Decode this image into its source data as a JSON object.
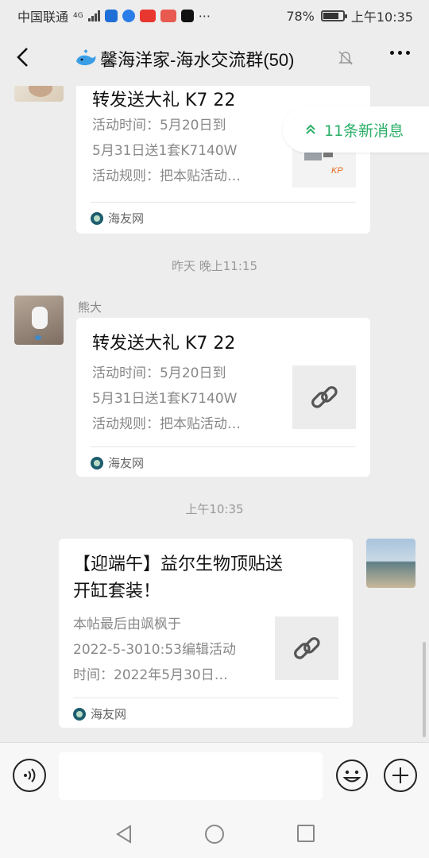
{
  "status_bar": {
    "carrier": "中国联通",
    "network": "4G",
    "battery": "78%",
    "battery_level": 0.78,
    "time": "上午10:35",
    "more": "···"
  },
  "header": {
    "title": "馨海洋家-海水交流群(50)"
  },
  "new_messages": "11条新消息",
  "messages": [
    {
      "card": {
        "title": "转发送大礼 K7 22",
        "desc_lines": [
          "活动时间：5月20日到",
          "5月31日送1套K7140W",
          "活动规则：把本贴活动…"
        ],
        "source": "海友网"
      }
    },
    {
      "timestamp": "昨天 晚上11:15",
      "sender": "熊大",
      "card": {
        "title": "转发送大礼 K7 22",
        "desc_lines": [
          "活动时间：5月20日到",
          "5月31日送1套K7140W",
          "活动规则：把本贴活动…"
        ],
        "source": "海友网"
      }
    },
    {
      "timestamp": "上午10:35",
      "card": {
        "title_lines": [
          "【迎端午】益尔生物顶贴送",
          "开缸套装！"
        ],
        "desc_lines": [
          "本帖最后由飒枫于",
          "2022-5-3010:53编辑活动",
          "时间：2022年5月30日…"
        ],
        "source": "海友网"
      }
    }
  ],
  "input": {
    "value": "",
    "placeholder": ""
  },
  "colors": {
    "background": "#ededed",
    "accent_green": "#2aae67",
    "card": "#ffffff"
  },
  "icons": [
    "back-icon",
    "whale-emoji-icon",
    "mute-bell-icon",
    "more-dots-icon",
    "voice-icon",
    "emoji-icon",
    "plus-icon",
    "link-icon",
    "double-chevron-up-icon"
  ]
}
